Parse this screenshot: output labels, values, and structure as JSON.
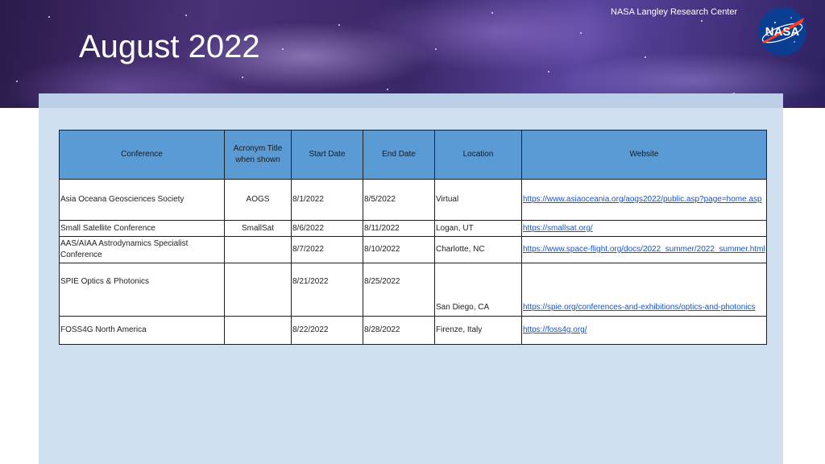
{
  "header": {
    "org_label": "NASA Langley Research Center",
    "title": "August 2022",
    "logo_text": "NASA"
  },
  "table": {
    "columns": [
      "Conference",
      "Acronym Title when shown",
      "Start Date",
      "End Date",
      "Location",
      "Website"
    ],
    "rows": [
      {
        "conference": "Asia Oceana Geosciences Society",
        "acronym": "AOGS",
        "start": "8/1/2022",
        "end": "8/5/2022",
        "location": "Virtual",
        "website": "https://www.asiaoceania.org/aogs2022/public.asp?page=home.asp"
      },
      {
        "conference": "Small Satellite Conference",
        "acronym": "SmallSat",
        "start": "8/6/2022",
        "end": "8/11/2022",
        "location": "Logan, UT",
        "website": "https://smallsat.org/"
      },
      {
        "conference": "AAS/AIAA Astrodynamics Specialist Conference",
        "acronym": "",
        "start": "8/7/2022",
        "end": "8/10/2022",
        "location": "Charlotte, NC",
        "website": "https://www.space-flight.org/docs/2022_summer/2022_summer.html"
      },
      {
        "conference": "SPIE Optics & Photonics",
        "acronym": "",
        "start": "8/21/2022",
        "end": "8/25/2022",
        "location": "San Diego, CA",
        "website": "https://spie.org/conferences-and-exhibitions/optics-and-photonics"
      },
      {
        "conference": "FOSS4G North America",
        "acronym": "",
        "start": "8/22/2022",
        "end": "8/28/2022",
        "location": "Firenze, Italy",
        "website": "https://foss4g.org/"
      }
    ]
  }
}
